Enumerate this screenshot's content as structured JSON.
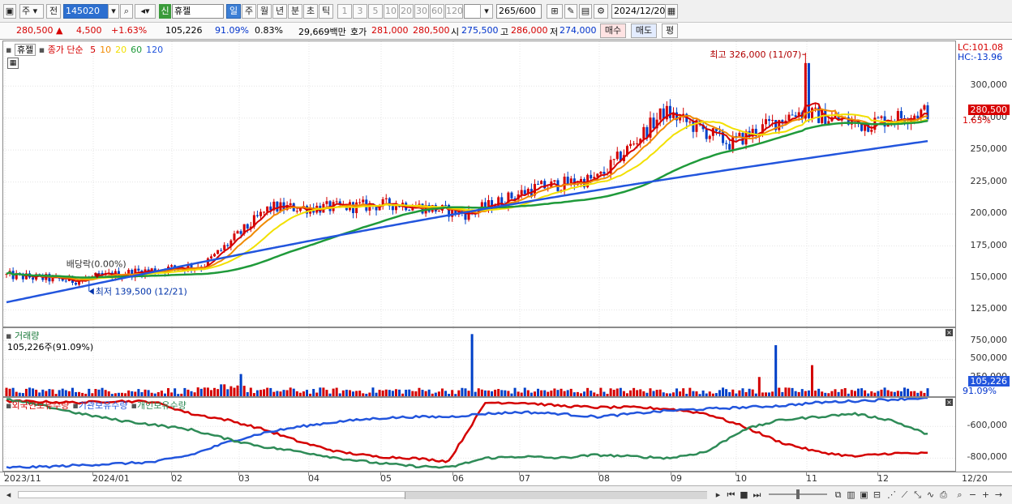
{
  "toolbar": {
    "market": "주",
    "prev_label": "전",
    "stock_code": "145020",
    "tag": "신",
    "stock_name": "휴젤",
    "periods": [
      {
        "label": "일",
        "active": true
      },
      {
        "label": "주",
        "active": false
      },
      {
        "label": "월",
        "active": false
      },
      {
        "label": "년",
        "active": false
      },
      {
        "label": "분",
        "active": false
      },
      {
        "label": "초",
        "active": false
      },
      {
        "label": "틱",
        "active": false
      }
    ],
    "intervals": [
      "1",
      "3",
      "5",
      "10",
      "20",
      "30",
      "60",
      "120"
    ],
    "count": "265",
    "count_total": "/600",
    "date": "2024/12/20"
  },
  "quote": {
    "price": "280,500",
    "change": "4,500",
    "change_pct": "+1.63%",
    "volume": "105,226",
    "volume_ratio": "91.09%",
    "turnover": "0.83%",
    "amount": "29,669백만",
    "ask_label": "호가",
    "ask1": "281,000",
    "ask2": "280,500",
    "open_label": "시",
    "open": "275,500",
    "high_label": "고",
    "high": "286,000",
    "low_label": "저",
    "low": "274,000",
    "buy_label": "매수",
    "sell_label": "매도",
    "eval_label": "평"
  },
  "price_panel": {
    "legend_name": "휴젤",
    "legend_ma_title": "종가 단순",
    "ma_periods": [
      {
        "p": "5",
        "color": "#d40000"
      },
      {
        "p": "10",
        "color": "#f08a00"
      },
      {
        "p": "20",
        "color": "#f2e000"
      },
      {
        "p": "60",
        "color": "#1f9a3a"
      },
      {
        "p": "120",
        "color": "#2255dd"
      }
    ],
    "lc": "LC:101.08",
    "hc": "HC:-13.96",
    "last_price": "280,500",
    "last_pct": "1.63%",
    "high_note": "최고 326,000 (11/07)",
    "low_note": "최저 139,500 (12/21)",
    "div_note": "배당락(0.00%)",
    "yticks": [
      "300,000",
      "275,000",
      "250,000",
      "225,000",
      "200,000",
      "175,000",
      "150,000",
      "125,000"
    ]
  },
  "volume_panel": {
    "title": "거래량",
    "value": "105,226주(91.09%)",
    "yticks": [
      "750,000",
      "500,000",
      "250,000"
    ],
    "last": "105,226",
    "last_pct": "91.09%"
  },
  "holding_panel": {
    "series": [
      {
        "name": "외국인보유수량",
        "color": "#d40000"
      },
      {
        "name": "기관보유수량",
        "color": "#2255dd"
      },
      {
        "name": "개인보유수량",
        "color": "#2e8b57"
      }
    ],
    "yticks": [
      "-600,000",
      "-800,000"
    ]
  },
  "xaxis": {
    "labels": [
      "2023/11",
      "2024/01",
      "02",
      "03",
      "04",
      "05",
      "06",
      "07",
      "08",
      "09",
      "10",
      "11",
      "12"
    ],
    "last": "12/20"
  },
  "chart_data": {
    "type": "line",
    "title": "휴젤",
    "price_range": [
      112000,
      335000
    ],
    "x_months": [
      "2023/11",
      "2023/12",
      "2024/01",
      "02",
      "03",
      "04",
      "05",
      "06",
      "07",
      "08",
      "09",
      "10",
      "11",
      "12"
    ],
    "close_approx": [
      152000,
      148000,
      155000,
      160000,
      205000,
      205000,
      208000,
      200000,
      220000,
      228000,
      280000,
      255000,
      280000,
      270000,
      280500
    ],
    "ma120_start": 131000,
    "ma120_end": 257000,
    "high": {
      "value": 326000,
      "date": "11/07"
    },
    "low": {
      "value": 139500,
      "date": "12/21"
    },
    "volume_range": [
      0,
      920000
    ],
    "volume_peaks": [
      {
        "month": "06",
        "value": 840000
      },
      {
        "month": "10",
        "value": 690000
      }
    ],
    "holding_range": [
      -880000,
      -420000
    ]
  }
}
